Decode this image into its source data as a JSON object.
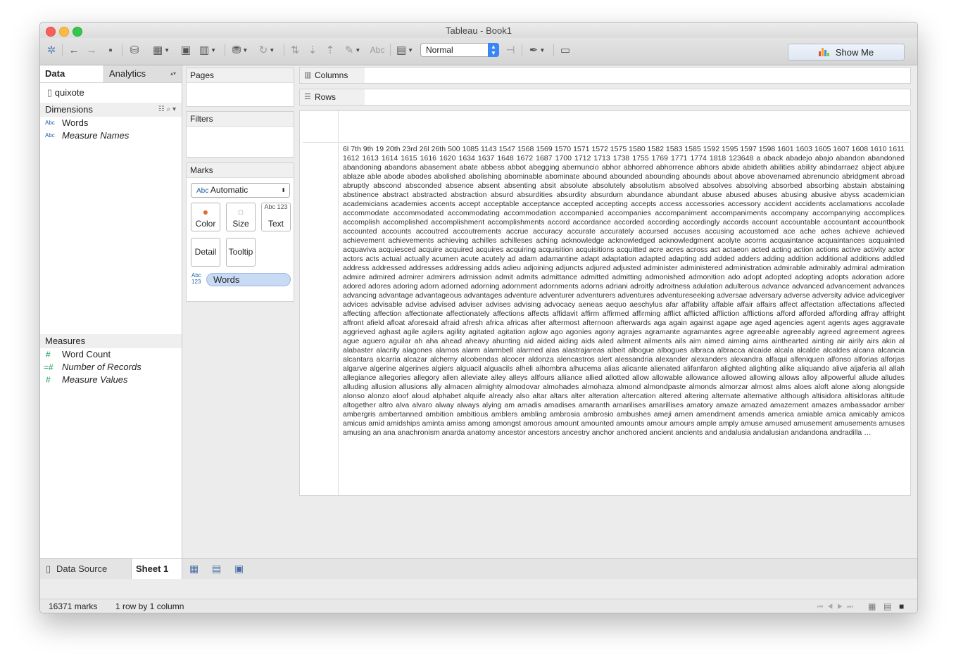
{
  "window": {
    "title": "Tableau - Book1"
  },
  "toolbar": {
    "format_select": "Normal",
    "abc_label": "Abc",
    "show_me_label": "Show Me",
    "show_me_colors": [
      "#e94b3c",
      "#f5a623",
      "#4a90d9",
      "#7ed321"
    ]
  },
  "left_pane": {
    "tabs": [
      "Data",
      "Analytics"
    ],
    "datasource": "quixote",
    "dimensions_header": "Dimensions",
    "dimensions": [
      {
        "type": "Abc",
        "name": "Words"
      },
      {
        "type": "Abc",
        "name": "Measure Names"
      }
    ],
    "measures_header": "Measures",
    "measures": [
      {
        "type": "#",
        "name": "Word Count"
      },
      {
        "type": "=#",
        "name": "Number of Records"
      },
      {
        "type": "#",
        "name": "Measure Values"
      }
    ]
  },
  "cards": {
    "pages": "Pages",
    "filters": "Filters",
    "marks": "Marks",
    "mark_type_icon": "Abc",
    "mark_type": "Automatic",
    "buttons": {
      "color": "Color",
      "size": "Size",
      "text": "Text",
      "text_icon": "Abc 123",
      "detail": "Detail",
      "tooltip": "Tooltip"
    },
    "pill_icon": "Abc 123",
    "pill": "Words"
  },
  "shelves": {
    "columns": "Columns",
    "rows": "Rows"
  },
  "viz": {
    "words_text": "6l 7th 9th 19 20th 23rd 26l 26th 500 1085 1143 1547 1568 1569 1570 1571 1572 1575 1580 1582 1583 1585 1592 1595 1597 1598 1601 1603 1605 1607 1608 1610 1611 1612 1613 1614 1615 1616 1620 1634 1637 1648 1672 1687 1700 1712 1713 1738 1755 1769 1771 1774 1818 123648 a aback abadejo abajo abandon abandoned abandoning abandons abasement abate abbess abbot abegging abernuncio abhor abhorred abhorrence abhors abide abideth abilities ability abindarraez abject abjure ablaze able abode abodes abolished abolishing abominable abominate abound abounded abounding abounds about above abovenamed abrenuncio abridgment abroad abruptly abscond absconded absence absent absenting absit absolute absolutely absolutism absolved absolves absolving absorbed absorbing abstain abstaining abstinence abstract abstracted abstraction absurd absurdities absurdity absurdum abundance abundant abuse abused abuses abusing abusive abyss academician academicians academies accents accept acceptable acceptance accepted accepting accepts access accessories accessory accident accidents acclamations accolade accommodate accommodated accommodating accommodation accompanied accompanies accompaniment accompaniments accompany accompanying accomplices accomplish accomplished accomplishment accomplishments accord accordance accorded according accordingly accords account accountable accountant accountbook accounted accounts accoutred accoutrements accrue accuracy accurate accurately accursed accuses accusing accustomed ace ache aches achieve achieved achievement achievements achieving achilles achilleses aching acknowledge acknowledged acknowledgment acolyte acorns acquaintance acquaintances acquainted acquaviva acquiesced acquire acquired acquires acquiring acquisition acquisitions acquitted acre acres across act actaeon acted acting action actions active activity actor actors acts actual actually acumen acute acutely ad adam adamantine adapt adaptation adapted adapting add added adders adding addition additional additions addled address addressed addresses addressing adds adieu adjoining adjuncts adjured adjusted administer administered administration admirable admirably admiral admiration admire admired admirer admirers admission admit admits admittance admitted admitting admonished admonition ado adopt adopted adopting adopts adoration adore adored adores adoring adorn adorned adorning adornment adornments adorns adriani adroitly adroitness adulation adulterous advance advanced advancement advances advancing advantage advantageous advantages adventure adventurer adventurers adventures adventureseeking adversae adversary adverse adversity advice advicegiver advices advisable advise advised adviser advises advising advocacy aeneas aequo aeschylus afar affability affable affair affairs affect affectation affectations affected affecting affection affectionate affectionately affections affects affidavit affirm affirmed affirming afflict afflicted affliction afflictions afford afforded affording affray affright affront afield afloat aforesaid afraid afresh africa africas after aftermost afternoon afterwards aga again against agape age aged agencies agent agents ages aggravate aggrieved aghast agile agilers agility agitated agitation aglow ago agonies agony agrajes agramante agramantes agree agreeable agreeably agreed agreement agrees ague aguero aguilar ah aha ahead aheavy ahunting aid aided aiding aids ailed ailment ailments ails aim aimed aiming aims ainthearted ainting air airily airs akin al alabaster alacrity alagones alamos alarm alarmbell alarmed alas alastrajareas albeit albogue albogues albraca albracca alcaide alcala alcalde alcaldes alcana alcancia alcantara alcarria alcazar alchemy alcobendas alcocer aldonza alencastros alert alessandria alexander alexanders alexandra alfaqui alfeniquen alfonso alforias alforjas algarve algerine algerines algiers alguacil alguacils alheli alhombra alhucema alias alicante alienated alifanfaron alighted alighting alike aliquando alive aljaferia all allah allegiance allegories allegory allen alleviate alley alleys allfours alliance allied allotted allow allowable allowance allowed allowing allows alloy allpowerful allude alludes alluding allusion allusions ally almacen almighty almodovar almohades almohaza almond almondpaste almonds almorzar almost alms aloes aloft alone along alongside alonso alonzo aloof aloud alphabet alquife already also altar altars alter alteration altercation altered altering alternate alternative although altisidora altisidoras altitude altogether altro alva alvaro alway always alying am amadis amadises amaranth amarilises amarillises amatory amaze amazed amazement amazes ambassador amber ambergris ambertanned ambition ambitious amblers ambling ambrosia ambrosio ambushes ameji amen amendment amends america amiable amica amicably amicos amicus amid amidships aminta amiss among amongst amorous amount amounted amounts amour amours ample amply amuse amused amusement amusements amuses amusing an ana anachronism anarda anatomy ancestor ancestors ancestry anchor anchored ancient ancients and andalusia andalusian andandona andradilla …"
  },
  "bottom": {
    "data_source_tab": "Data Source",
    "sheet_tab": "Sheet 1"
  },
  "status": {
    "marks": "16371 marks",
    "dims": "1 row by 1 column"
  }
}
